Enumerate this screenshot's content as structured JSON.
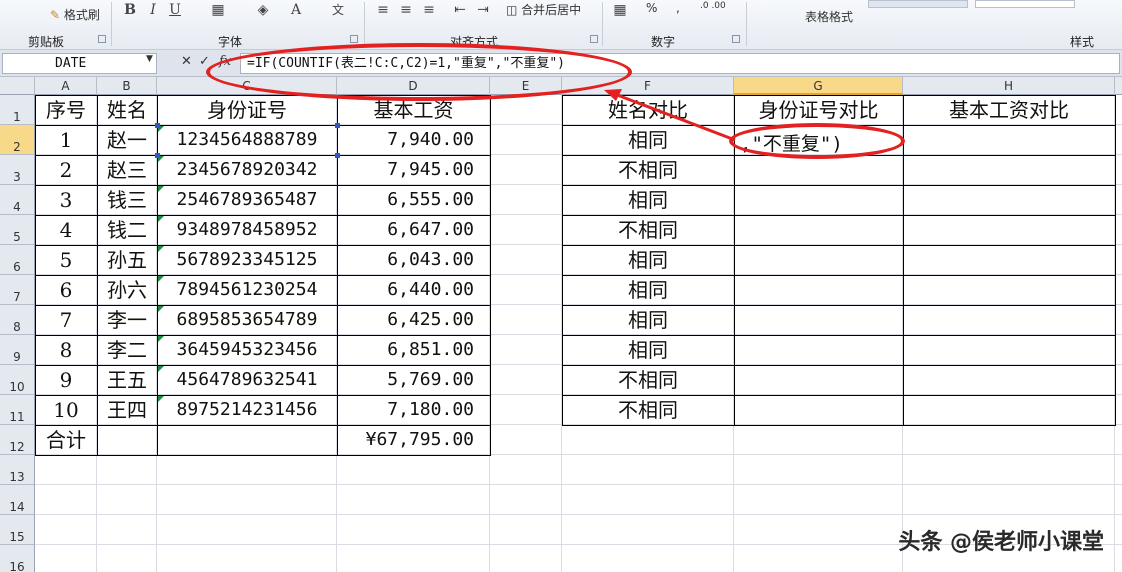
{
  "ribbon": {
    "format_painter": "格式刷",
    "groups": [
      "剪贴板",
      "字体",
      "对齐方式",
      "数字",
      "样式"
    ],
    "merge_center": "合并后居中",
    "table_format": "表格格式",
    "number_format_sign": "%",
    "comma": ","
  },
  "formula_bar": {
    "name_box": "DATE",
    "fx_label": "fx",
    "cancel_icon": "✕",
    "enter_icon": "✓",
    "formula": "=IF(COUNTIF(表二!C:C,C2)=1,\"重复\",\"不重复\")"
  },
  "columns": [
    "A",
    "B",
    "C",
    "D",
    "E",
    "F",
    "G",
    "H"
  ],
  "rows": [
    "1",
    "2",
    "3",
    "4",
    "5",
    "6",
    "7",
    "8",
    "9",
    "10",
    "11",
    "12",
    "13",
    "14",
    "15",
    "16"
  ],
  "table1": {
    "headers": [
      "序号",
      "姓名",
      "身份证号",
      "基本工资"
    ],
    "rows": [
      [
        "1",
        "赵一",
        "1234564888789",
        "7,940.00"
      ],
      [
        "2",
        "赵三",
        "2345678920342",
        "7,945.00"
      ],
      [
        "3",
        "钱三",
        "2546789365487",
        "6,555.00"
      ],
      [
        "4",
        "钱二",
        "9348978458952",
        "6,647.00"
      ],
      [
        "5",
        "孙五",
        "5678923345125",
        "6,043.00"
      ],
      [
        "6",
        "孙六",
        "7894561230254",
        "6,440.00"
      ],
      [
        "7",
        "李一",
        "6895853654789",
        "6,425.00"
      ],
      [
        "8",
        "李二",
        "3645945323456",
        "6,851.00"
      ],
      [
        "9",
        "王五",
        "4564789632541",
        "5,769.00"
      ],
      [
        "10",
        "王四",
        "8975214231456",
        "7,180.00"
      ]
    ],
    "total_label": "合计",
    "total_value": "¥67,795.00"
  },
  "table2": {
    "headers": [
      "姓名对比",
      "身份证号对比",
      "基本工资对比"
    ],
    "name_compare": [
      "相同",
      "不相同",
      "相同",
      "不相同",
      "相同",
      "相同",
      "相同",
      "相同",
      "不相同",
      "不相同"
    ],
    "editing_text": ",\"不重复\")"
  },
  "watermark": "头条 @侯老师小课堂",
  "colors": {
    "annotation": "#e32121",
    "selection": "#2e58c6",
    "active_header": "#f8d98a"
  }
}
